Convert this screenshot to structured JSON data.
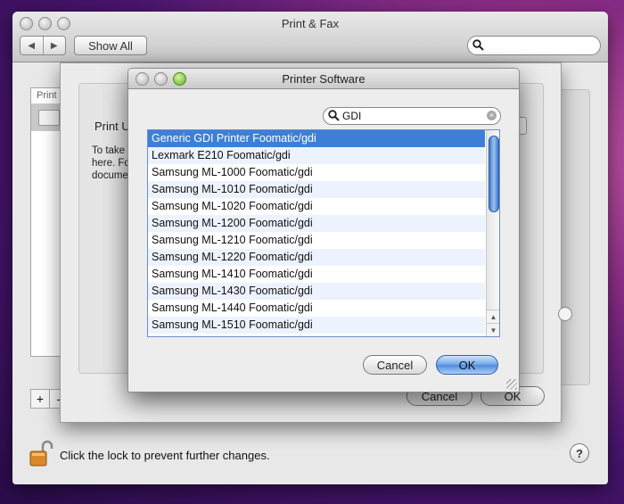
{
  "main_window": {
    "title": "Print & Fax",
    "nav_back": "◀",
    "nav_forward": "▶",
    "show_all": "Show All",
    "search_value": "",
    "printer_list_header": "Print",
    "add_label": "+",
    "remove_label": "-",
    "lock_text": "Click the lock to prevent further changes.",
    "help_label": "?"
  },
  "add_printer_sheet": {
    "label": "Print U",
    "description": "To take here. Fo docume",
    "cancel_label": "Cancel",
    "ok_label": "OK"
  },
  "printer_software": {
    "title": "Printer Software",
    "search_value": "GDI",
    "selected_index": 0,
    "items": [
      "Generic GDI Printer Foomatic/gdi",
      "Lexmark E210 Foomatic/gdi",
      "Samsung ML-1000 Foomatic/gdi",
      "Samsung ML-1010 Foomatic/gdi",
      "Samsung ML-1020 Foomatic/gdi",
      "Samsung ML-1200 Foomatic/gdi",
      "Samsung ML-1210 Foomatic/gdi",
      "Samsung ML-1220 Foomatic/gdi",
      "Samsung ML-1410 Foomatic/gdi",
      "Samsung ML-1430 Foomatic/gdi",
      "Samsung ML-1440 Foomatic/gdi",
      "Samsung ML-1510 Foomatic/gdi"
    ],
    "cancel_label": "Cancel",
    "ok_label": "OK"
  },
  "colors": {
    "selection": "#3d7fd6",
    "alt_row": "#edf3fe",
    "ok_button": "#6fa6e8"
  },
  "icons": [
    "search-icon",
    "lock-icon",
    "printer-icon",
    "help-icon",
    "scroll-up-icon",
    "scroll-down-icon"
  ]
}
